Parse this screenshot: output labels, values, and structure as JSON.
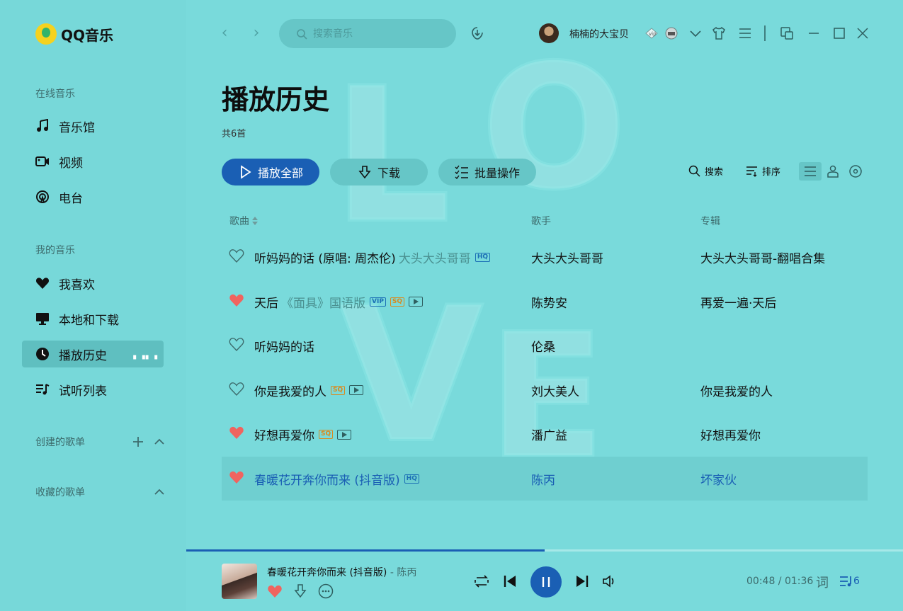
{
  "app": {
    "name": "QQ音乐"
  },
  "sidebar": {
    "online_music_label": "在线音乐",
    "online_items": [
      {
        "label": "音乐馆",
        "icon": "music-note-icon"
      },
      {
        "label": "视频",
        "icon": "video-icon"
      },
      {
        "label": "电台",
        "icon": "radio-icon"
      }
    ],
    "my_music_label": "我的音乐",
    "my_items": [
      {
        "label": "我喜欢",
        "icon": "heart-icon"
      },
      {
        "label": "本地和下载",
        "icon": "monitor-icon"
      },
      {
        "label": "播放历史",
        "icon": "clock-icon",
        "active": true
      },
      {
        "label": "试听列表",
        "icon": "playlist-icon"
      }
    ],
    "created_playlists_label": "创建的歌单",
    "collected_playlists_label": "收藏的歌单"
  },
  "topbar": {
    "search_placeholder": "搜索音乐",
    "username": "楠楠的大宝贝"
  },
  "page": {
    "title": "播放历史",
    "count": "共6首",
    "play_all": "播放全部",
    "download": "下载",
    "batch": "批量操作",
    "search_tool": "搜索",
    "sort_tool": "排序"
  },
  "columns": {
    "song": "歌曲",
    "artist": "歌手",
    "album": "专辑"
  },
  "songs": [
    {
      "title": "听妈妈的话 (原唱: 周杰伦)",
      "sub": "大头大头哥哥",
      "tags": [
        "HQ"
      ],
      "artist": "大头大头哥哥",
      "album": "大头大头哥哥-翻唱合集",
      "liked": false,
      "current": false
    },
    {
      "title": "天后",
      "sub": "《面具》国语版",
      "tags": [
        "VIP",
        "SQ",
        "MV"
      ],
      "artist": "陈势安",
      "album": "再爱一遍·天后",
      "liked": true,
      "current": false
    },
    {
      "title": "听妈妈的话",
      "sub": "",
      "tags": [],
      "artist": "伦桑",
      "album": "",
      "liked": false,
      "current": false
    },
    {
      "title": "你是我爱的人",
      "sub": "",
      "tags": [
        "SQ",
        "MV"
      ],
      "artist": "刘大美人",
      "album": "你是我爱的人",
      "liked": false,
      "current": false
    },
    {
      "title": "好想再爱你",
      "sub": "",
      "tags": [
        "SQ",
        "MV"
      ],
      "artist": "潘广益",
      "album": "好想再爱你",
      "liked": true,
      "current": false
    },
    {
      "title": "春暖花开奔你而来 (抖音版)",
      "sub": "",
      "tags": [
        "HQ"
      ],
      "artist": "陈丙",
      "album": "坏家伙",
      "liked": true,
      "current": true
    }
  ],
  "player": {
    "title": "春暖花开奔你而来 (抖音版)",
    "separator": " - ",
    "artist": "陈丙",
    "time": "00:48 / 01:36",
    "progress": 0.5,
    "lyric_label": "词",
    "queue_count": "6"
  },
  "colors": {
    "accent": "#1a5fb4",
    "background": "#79dadb",
    "heart": "#f0645f"
  }
}
